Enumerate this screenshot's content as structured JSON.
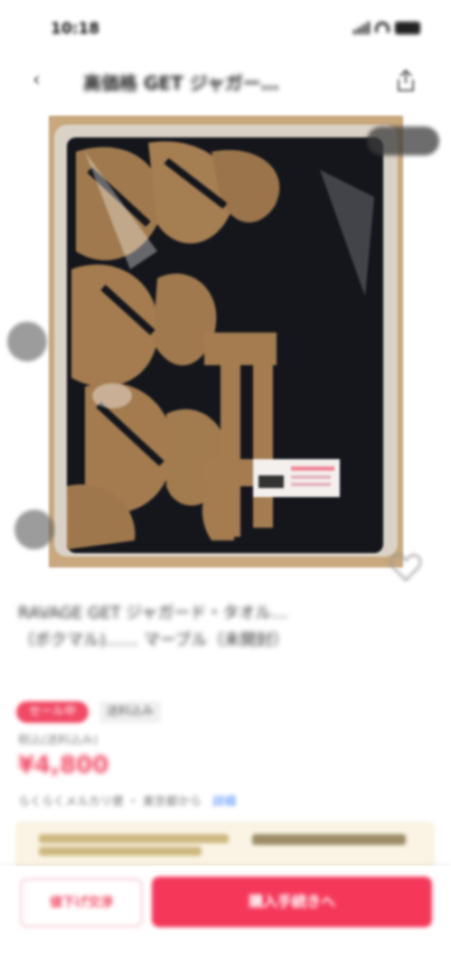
{
  "status_bar": {
    "time": "10:18"
  },
  "header": {
    "title": "高価格 GET ジャガー…",
    "back_icon": "chevron-left-icon",
    "share_icon": "share-icon"
  },
  "photo": {
    "alt_subject": "packaged black and tan jacquard towel",
    "bg_color": "#c8a87c"
  },
  "item": {
    "title": "RAVAGE GET ジャガード・タオル…\n（ボクマル)…… マーブル（未開封）",
    "tag_sale": "セール中",
    "tag_plain": "送料込み",
    "tax_note": "税込(送料込み)",
    "price": "¥4,800",
    "shipping": "らくらくメルカリ便 ・ 東京都から",
    "shipping_info": "詳細"
  },
  "banner": {
    "label": "メルカードで買うと…"
  },
  "bottom_bar": {
    "offer_label": "値下げ交渉",
    "buy_label": "購入手続きへ"
  },
  "colors": {
    "accent": "#f5385a",
    "price": "#f14a65",
    "banner_bg": "#fbf4e4"
  }
}
